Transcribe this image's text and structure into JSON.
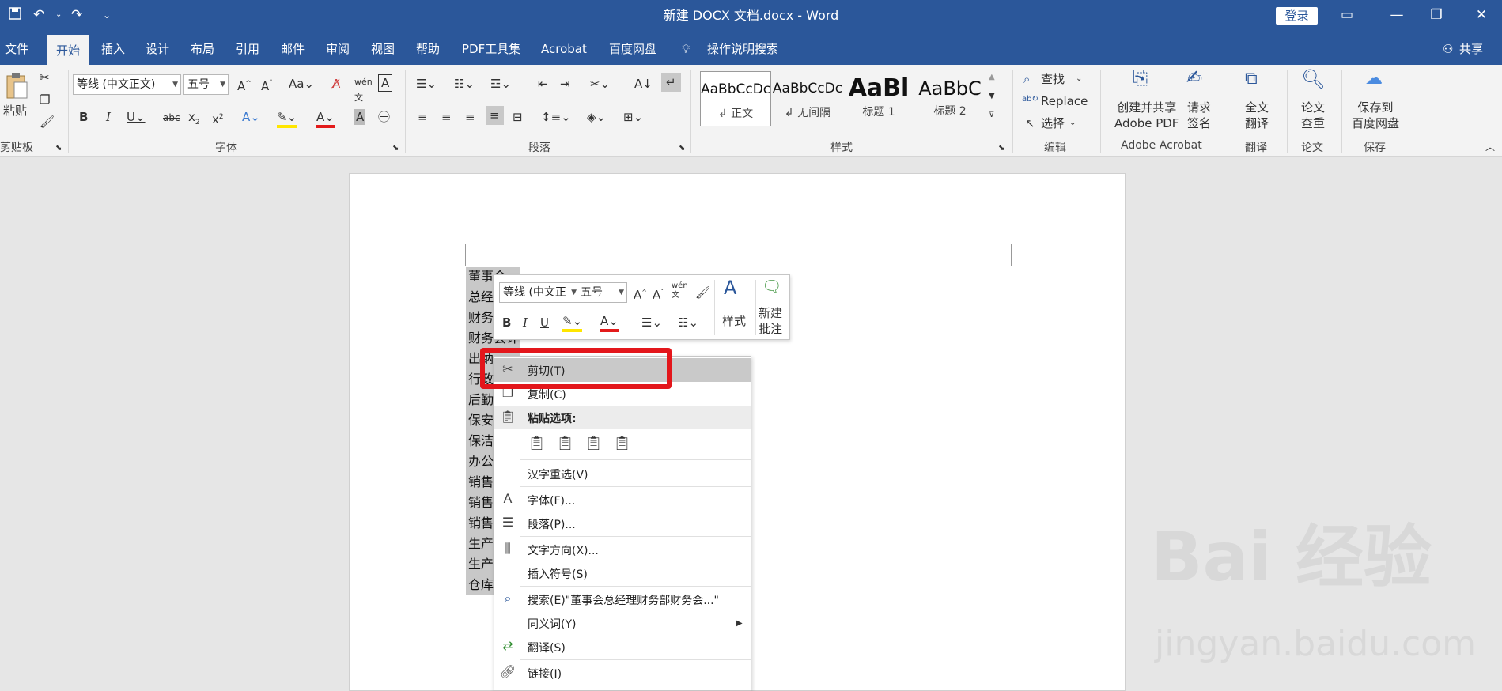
{
  "titlebar": {
    "doc_title": "新建 DOCX 文档.docx  -  Word",
    "login_label": "登录"
  },
  "tabs": [
    "文件",
    "开始",
    "插入",
    "设计",
    "布局",
    "引用",
    "邮件",
    "审阅",
    "视图",
    "帮助",
    "PDF工具集",
    "Acrobat",
    "百度网盘"
  ],
  "tell_me": "操作说明搜索",
  "share": "共享",
  "ribbon": {
    "paste_label": "粘贴",
    "font_name": "等线 (中文正文)",
    "font_size": "五号",
    "find": "查找",
    "replace": "Replace",
    "select": "选择",
    "create_pdf_l1": "创建并共享",
    "create_pdf_l2": "Adobe PDF",
    "request_l1": "请求",
    "request_l2": "签名",
    "translate_l1": "全文",
    "translate_l2": "翻译",
    "check_l1": "论文",
    "check_l2": "查重",
    "save_baidu_l1": "保存到",
    "save_baidu_l2": "百度网盘",
    "styles": [
      {
        "sample": "AaBbCcDc",
        "name": "↲ 正文"
      },
      {
        "sample": "AaBbCcDc",
        "name": "↲ 无间隔"
      },
      {
        "sample": "AaBl",
        "name": "标题 1"
      },
      {
        "sample": "AaBbC",
        "name": "标题 2"
      }
    ],
    "groups": [
      "剪贴板",
      "字体",
      "段落",
      "样式",
      "编辑",
      "Adobe Acrobat",
      "翻译",
      "论文",
      "保存"
    ]
  },
  "document": {
    "lines": [
      "董事会",
      "总经",
      "财务",
      "财务会计",
      "出纳",
      "行政",
      "后勤",
      "保安",
      "保洁",
      "办公",
      "销售",
      "销售",
      "销售",
      "生产",
      "生产",
      "仓库"
    ]
  },
  "minibar": {
    "font_name": "等线 (中文正",
    "font_size": "五号",
    "styles_label": "样式",
    "new_comment_l1": "新建",
    "new_comment_l2": "批注"
  },
  "context_menu": {
    "cut": "剪切(T)",
    "copy": "复制(C)",
    "paste_options": "粘贴选项:",
    "reconvert": "汉字重选(V)",
    "font": "字体(F)...",
    "paragraph": "段落(P)...",
    "text_direction": "文字方向(X)...",
    "insert_symbol": "插入符号(S)",
    "search": "搜索(E)\"董事会总经理财务部财务会...\"",
    "synonyms": "同义词(Y)",
    "translate": "翻译(S)",
    "link": "链接(I)"
  },
  "watermark": {
    "brand": "Bai 经验",
    "url": "jingyan.baidu.com"
  },
  "colors": {
    "word_blue": "#2b579a",
    "highlight_red": "#e3161b",
    "selection_gray": "#c8c8c8"
  }
}
